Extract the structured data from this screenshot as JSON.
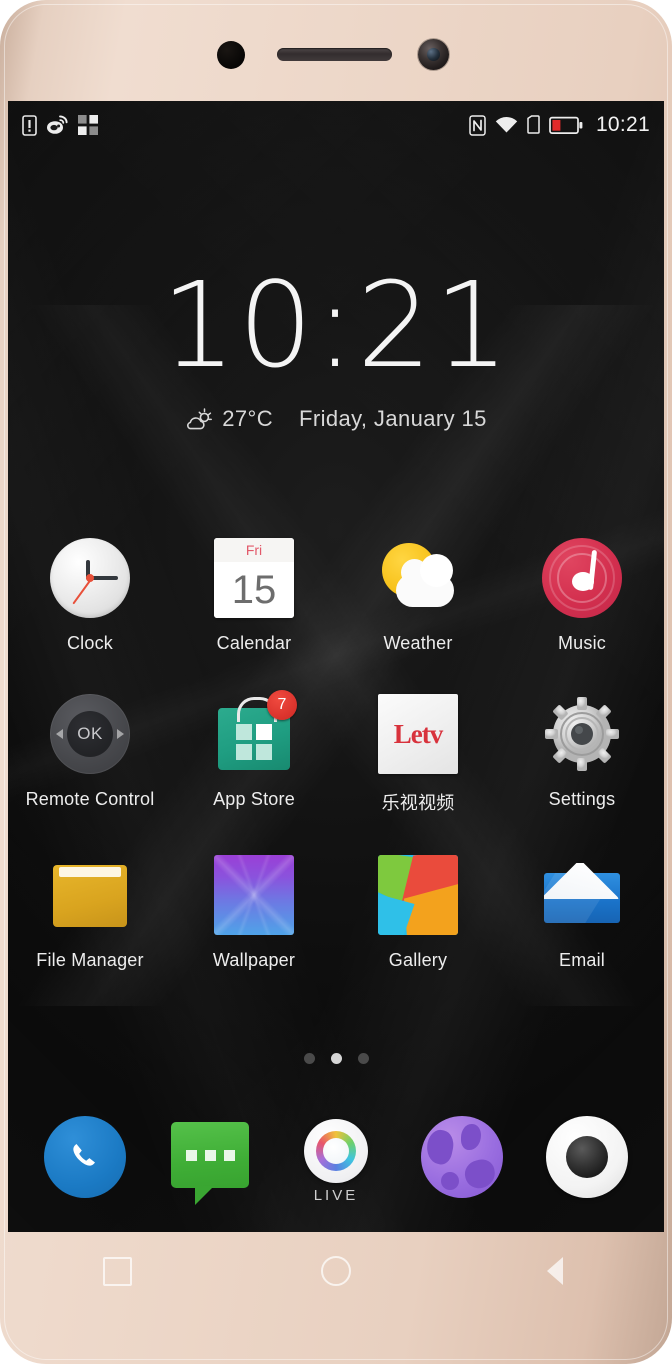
{
  "device": {
    "bezel_color": "#ecd6c7",
    "hardware": {
      "sensor": "proximity-sensor",
      "earpiece": "earpiece-speaker",
      "front_camera": "front-camera"
    }
  },
  "status_bar": {
    "left_icons": [
      "sim-alert-icon",
      "weibo-icon",
      "app-grid-icon"
    ],
    "right_icons": [
      "nfc-icon",
      "wifi-icon",
      "sim-card-icon",
      "battery-low-icon"
    ],
    "clock": "10:21",
    "battery_color": "#e12a2a"
  },
  "clock_widget": {
    "time": "10:21",
    "temperature": "27°C",
    "date": "Friday, January 15",
    "weather_icon": "sun-cloud-icon"
  },
  "app_grid": {
    "rows": [
      [
        {
          "label": "Clock",
          "icon": "clock-icon"
        },
        {
          "label": "Calendar",
          "icon": "calendar-icon",
          "weekday": "Fri",
          "day": "15"
        },
        {
          "label": "Weather",
          "icon": "weather-icon"
        },
        {
          "label": "Music",
          "icon": "music-icon"
        }
      ],
      [
        {
          "label": "Remote Control",
          "icon": "remote-control-icon",
          "center_text": "OK"
        },
        {
          "label": "App Store",
          "icon": "app-store-icon",
          "badge": "7"
        },
        {
          "label": "乐视视频",
          "icon": "letv-icon",
          "logo_text": "Letv"
        },
        {
          "label": "Settings",
          "icon": "settings-gear-icon"
        }
      ],
      [
        {
          "label": "File Manager",
          "icon": "folder-icon"
        },
        {
          "label": "Wallpaper",
          "icon": "wallpaper-icon"
        },
        {
          "label": "Gallery",
          "icon": "gallery-icon"
        },
        {
          "label": "Email",
          "icon": "email-icon"
        }
      ]
    ]
  },
  "page_indicator": {
    "total": 3,
    "active_index": 1
  },
  "dock": {
    "items": [
      {
        "label": "",
        "icon": "phone-icon"
      },
      {
        "label": "",
        "icon": "messages-icon"
      },
      {
        "label": "LIVE",
        "icon": "live-icon"
      },
      {
        "label": "",
        "icon": "browser-icon"
      },
      {
        "label": "",
        "icon": "camera-icon"
      }
    ]
  },
  "nav_bar": {
    "buttons": [
      {
        "name": "recents",
        "icon": "square-icon"
      },
      {
        "name": "home",
        "icon": "circle-icon"
      },
      {
        "name": "back",
        "icon": "triangle-left-icon"
      }
    ]
  },
  "colors": {
    "music": "#d32f4e",
    "app_store": "#1f9d81",
    "letv_red": "#d8323c",
    "folder": "#d9a41f",
    "email_blue": "#1a72c8",
    "phone_blue": "#1b7ac4",
    "messages_green": "#3fae36",
    "browser_purple": "#9a6ee0"
  }
}
